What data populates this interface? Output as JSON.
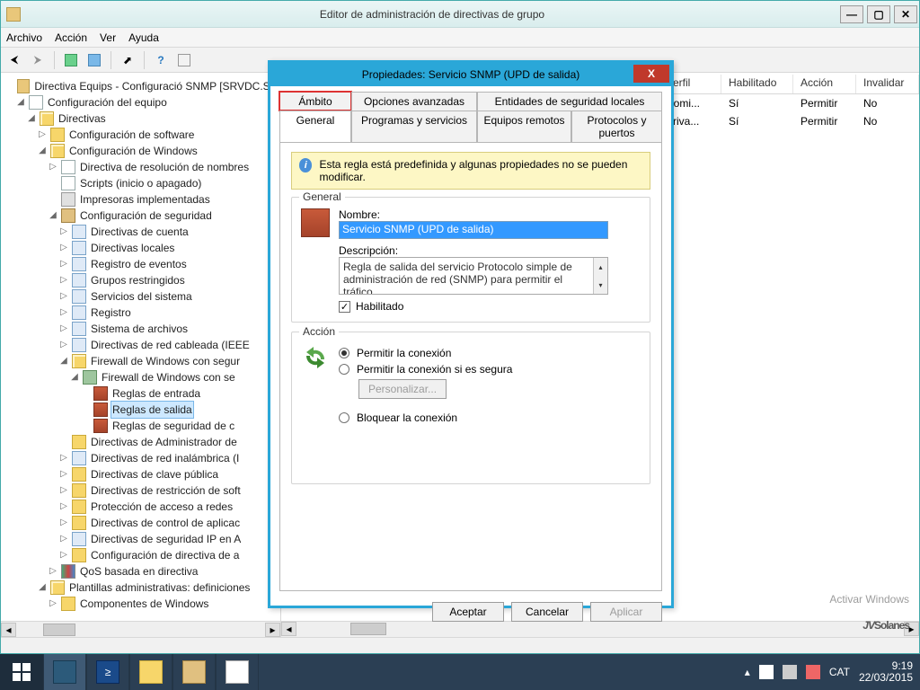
{
  "window": {
    "title": "Editor de administración de directivas de grupo",
    "menus": [
      "Archivo",
      "Acción",
      "Ver",
      "Ayuda"
    ]
  },
  "tree": {
    "root": "Directiva Equips - Configuració SNMP [SRVDC.SO",
    "n1": "Configuración del equipo",
    "n2": "Directivas",
    "n3": "Configuración de software",
    "n4": "Configuración de Windows",
    "n5": "Directiva de resolución de nombres",
    "n6": "Scripts (inicio o apagado)",
    "n7": "Impresoras implementadas",
    "n8": "Configuración de seguridad",
    "n9": "Directivas de cuenta",
    "n10": "Directivas locales",
    "n11": "Registro de eventos",
    "n12": "Grupos restringidos",
    "n13": "Servicios del sistema",
    "n14": "Registro",
    "n15": "Sistema de archivos",
    "n16": "Directivas de red cableada (IEEE",
    "n17": "Firewall de Windows con segur",
    "n18": "Firewall de Windows con se",
    "n19": "Reglas de entrada",
    "n20": "Reglas de salida",
    "n21": "Reglas de seguridad de c",
    "n22": "Directivas de Administrador de",
    "n23": "Directivas de red inalámbrica (I",
    "n24": "Directivas de clave pública",
    "n25": "Directivas de restricción de soft",
    "n26": "Protección de acceso a redes",
    "n27": "Directivas de control de aplicac",
    "n28": "Directivas de seguridad IP en A",
    "n29": "Configuración de directiva de a",
    "n30": "QoS basada en directiva",
    "n31": "Plantillas administrativas: definiciones",
    "n32": "Componentes de Windows"
  },
  "list": {
    "columns": [
      "Perfil",
      "Habilitado",
      "Acción",
      "Invalidar"
    ],
    "rows": [
      {
        "c0": "Domi...",
        "c1": "Sí",
        "c2": "Permitir",
        "c3": "No"
      },
      {
        "c0": "Priva...",
        "c1": "Sí",
        "c2": "Permitir",
        "c3": "No"
      }
    ]
  },
  "dialog": {
    "title": "Propiedades: Servicio SNMP (UPD de salida)",
    "tabs_row1": [
      "Ámbito",
      "Opciones avanzadas",
      "Entidades de seguridad locales"
    ],
    "tabs_row2": [
      "General",
      "Programas y servicios",
      "Equipos remotos",
      "Protocolos y puertos"
    ],
    "info": "Esta regla está predefinida y algunas propiedades no se pueden modificar.",
    "group_general": "General",
    "name_label": "Nombre:",
    "name_value": "Servicio SNMP (UPD de salida)",
    "desc_label": "Descripción:",
    "desc_value": "Regla de salida del servicio Protocolo simple de administración de red (SNMP) para permitir el tráfico",
    "enabled_label": "Habilitado",
    "group_action": "Acción",
    "opt_allow": "Permitir la conexión",
    "opt_allow_secure": "Permitir la conexión si es segura",
    "btn_customize": "Personalizar...",
    "opt_block": "Bloquear la conexión",
    "btn_ok": "Aceptar",
    "btn_cancel": "Cancelar",
    "btn_apply": "Aplicar"
  },
  "watermark": {
    "line1": "Activar Windows",
    "brand": "JVSolanes"
  },
  "taskbar": {
    "lang": "CAT",
    "time": "9:19",
    "date": "22/03/2015"
  }
}
